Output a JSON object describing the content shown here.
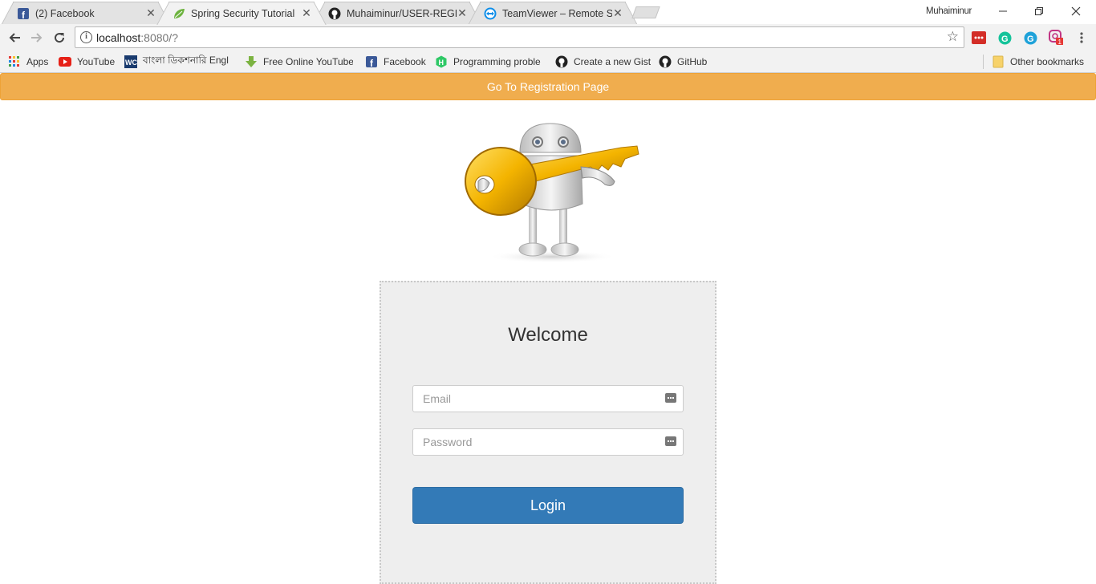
{
  "browser": {
    "tabs": [
      {
        "title": "(2) Facebook",
        "icon": "facebook-icon",
        "active": false
      },
      {
        "title": "Spring Security Tutorial",
        "icon": "spring-leaf-icon",
        "active": true
      },
      {
        "title": "Muhaiminur/USER-REGIS",
        "icon": "github-icon",
        "active": false
      },
      {
        "title": "TeamViewer – Remote Su",
        "icon": "teamviewer-icon",
        "active": false
      }
    ],
    "profile_name": "Muhaiminur",
    "address": {
      "host": "localhost",
      "path": ":8080/?"
    },
    "bookmarks": [
      {
        "label": "Apps",
        "icon": "apps-grid-icon"
      },
      {
        "label": "YouTube",
        "icon": "youtube-icon"
      },
      {
        "label": "বাংলা ডিকশনারি Engl",
        "icon": "dictionary-icon"
      },
      {
        "label": "Free Online YouTube",
        "icon": "download-arrow-icon"
      },
      {
        "label": "Facebook",
        "icon": "facebook-icon"
      },
      {
        "label": "Programming proble",
        "icon": "hackerrank-icon"
      },
      {
        "label": "Create a new Gist",
        "icon": "github-icon"
      },
      {
        "label": "GitHub",
        "icon": "github-icon"
      }
    ],
    "other_bookmarks": "Other bookmarks",
    "extension_badge": "1"
  },
  "page": {
    "registration_link": "Go To Registration Page",
    "welcome": "Welcome",
    "email_placeholder": "Email",
    "password_placeholder": "Password",
    "login_label": "Login"
  },
  "colors": {
    "registration_bar": "#f0ad4e",
    "login_button": "#337ab7",
    "card_background": "#eeeeee"
  }
}
